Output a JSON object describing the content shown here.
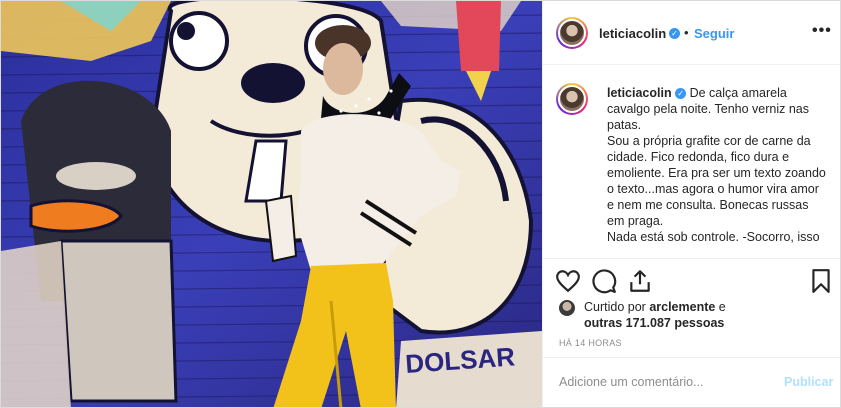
{
  "post": {
    "username": "leticiacolin",
    "follow_label": "Seguir",
    "separator": "•",
    "more_label": "•••",
    "verified_glyph": "✓",
    "caption_text": "De calça amarela cavalgo pela noite. Tenho verniz nas patas.\nSou a própria grafite cor de carne da cidade. Fico redonda, fico dura e emoliente. Era pra ser um texto zoando o texto...mas agora o humor vira amor e nem me consulta. Bonecas russas em praga.\nNada está sob controle. -Socorro, isso",
    "likes_prefix": "Curtido por ",
    "likes_user": "arclemente",
    "likes_mid": " e ",
    "likes_others": "outras 171.087 pessoas",
    "timestamp": "HÁ 14 HORAS",
    "comment_placeholder": "Adicione um comentário...",
    "publish_label": "Publicar"
  },
  "icons": {
    "like": "heart-icon",
    "comment": "comment-icon",
    "share": "share-icon",
    "save": "bookmark-icon",
    "verified": "verified-badge-icon",
    "more": "more-options-icon"
  },
  "colors": {
    "link": "#3897f0",
    "publish_disabled": "#b2dffc",
    "muted": "#8e8e8e",
    "text": "#262626"
  }
}
